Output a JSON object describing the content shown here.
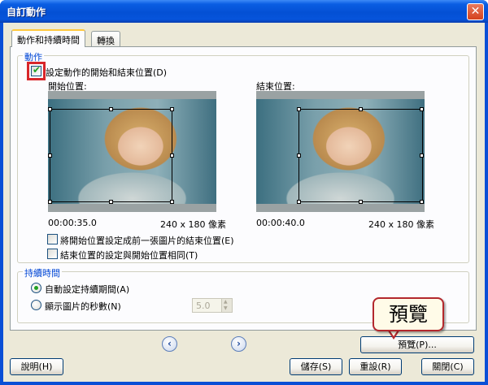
{
  "window": {
    "title": "自訂動作",
    "close_glyph": "✕"
  },
  "tabs": [
    {
      "label": "動作和持續時間"
    },
    {
      "label": "轉換"
    }
  ],
  "motion_group": {
    "legend": "動作",
    "set_motion_checkbox": {
      "label": "設定動作的開始和結束位置(D)",
      "checked": true
    },
    "start": {
      "label": "開始位置:",
      "timecode": "00:00:35.0",
      "size": "240 x 180 像素"
    },
    "end": {
      "label": "結束位置:",
      "timecode": "00:00:40.0",
      "size": "240 x 180 像素"
    },
    "option_same_as_prev": {
      "label": "將開始位置設定成前一張圖片的結束位置(E)",
      "checked": false
    },
    "option_end_same_as_start": {
      "label": "結束位置的設定與開始位置相同(T)",
      "checked": false
    }
  },
  "duration_group": {
    "legend": "持續時間",
    "auto_radio": {
      "label": "自動設定持續期間(A)",
      "selected": true
    },
    "seconds_radio": {
      "label": "顯示圖片的秒數(N)",
      "selected": false
    },
    "seconds_value": "5.0"
  },
  "nav": {
    "prev_glyph": "‹",
    "next_glyph": "›"
  },
  "callout": {
    "text": "預覽"
  },
  "buttons": {
    "preview": "預覽(P)...",
    "help": "說明(H)",
    "save": "儲存(S)",
    "reset": "重設(R)",
    "close": "關閉(C)"
  },
  "colors": {
    "titlebar": "#0a5ee3",
    "legend_text": "#0046d5",
    "highlight": "#d8262a",
    "check": "#21a121"
  }
}
